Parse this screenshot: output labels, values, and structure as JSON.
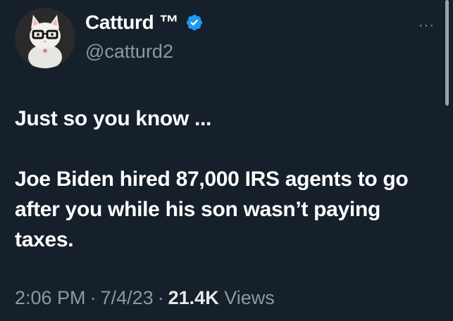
{
  "author": {
    "display_name": "Catturd ™",
    "handle": "@catturd2",
    "verified": true
  },
  "more_menu": "···",
  "tweet": {
    "line1": "Just so you know ...",
    "body": "Joe Biden hired 87,000 IRS agents to go after you while his son wasn’t paying taxes."
  },
  "meta": {
    "time": "2:06 PM",
    "date": "7/4/23",
    "views_count": "21.4K",
    "views_label": "Views",
    "separator": "·"
  },
  "colors": {
    "background": "#15202b",
    "text": "#ffffff",
    "muted": "#8b98a5",
    "verified_badge": "#1d9bf0"
  },
  "icons": {
    "verified": "verified-badge-icon",
    "more": "more-options-icon"
  }
}
